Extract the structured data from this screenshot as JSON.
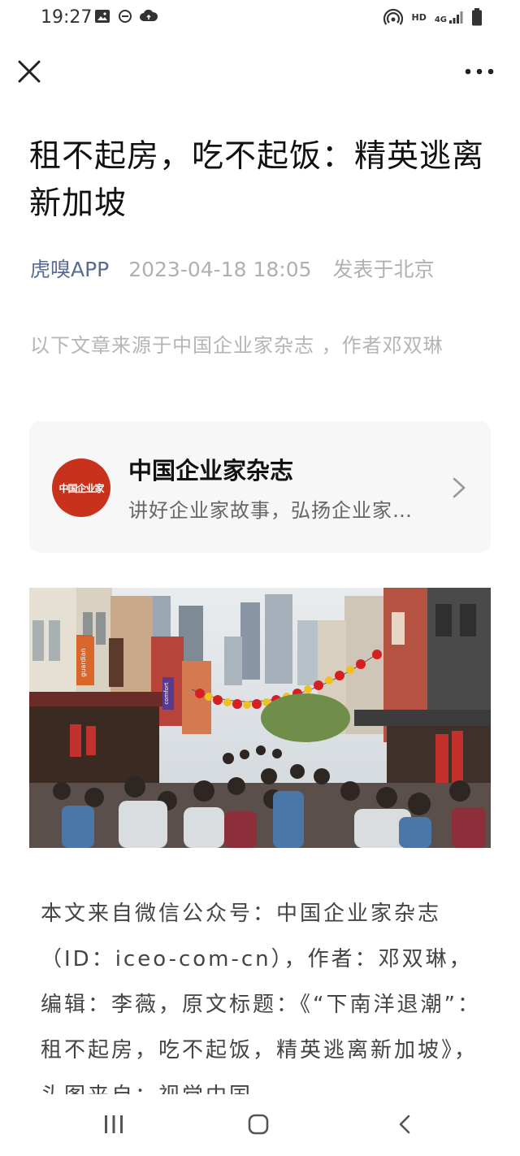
{
  "status_bar": {
    "time": "19:27",
    "network_hd": "HD",
    "network_type": "4G",
    "left_icons": [
      "image-icon",
      "do-not-disturb-icon",
      "cloud-sync-icon"
    ],
    "right_icons": [
      "hotspot-icon",
      "signal-icon",
      "battery-icon"
    ]
  },
  "app_bar": {
    "close_icon": "close-icon",
    "more_icon": "more-icon"
  },
  "article": {
    "title": "租不起房，吃不起饭：精英逃离新加坡",
    "author": "虎嗅APP",
    "date": "2023-04-18 18:05",
    "location": "发表于北京",
    "source_note": "以下文章来源于中国企业家杂志 ，作者邓双琳",
    "body": "本文来自微信公众号：中国企业家杂志（ID：iceo-com-cn），作者：邓双琳，编辑：李薇，原文标题：《“下南洋退潮”：租不起房，吃不起饭，精英逃离新加坡》，头图来自：视觉中国"
  },
  "account_card": {
    "logo_text": "中国企业家",
    "name": "中国企业家杂志",
    "description": "讲好企业家故事，弘扬企业家精神"
  },
  "hero_image": {
    "signs": [
      "guardian",
      "comfort"
    ]
  },
  "nav_bar": {
    "icons": [
      "recent-apps-icon",
      "home-icon",
      "back-icon"
    ]
  },
  "colors": {
    "author_link": "#576b95",
    "meta_gray": "#b0b0b0",
    "card_bg": "#f7f7f7",
    "logo_red": "#c8321d"
  }
}
